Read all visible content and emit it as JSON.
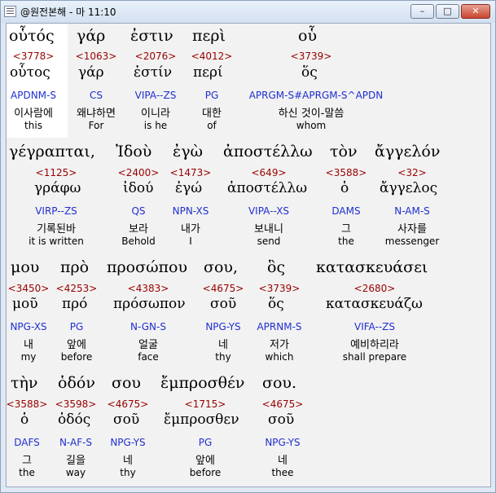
{
  "window": {
    "title": "@원전본해 - 마 11:10",
    "minimize": "–",
    "maximize": "□",
    "close": "✕"
  },
  "rows": [
    {
      "words": [
        {
          "greek": "οὗτός",
          "strong": "<3778>",
          "lemma": "οὗτος",
          "parse": "APDNM-S",
          "korean": "이사람에",
          "english": "this"
        },
        {
          "greek": "γάρ",
          "strong": "<1063>",
          "lemma": "γάρ",
          "parse": "CS",
          "korean": "왜냐하면",
          "english": "For"
        },
        {
          "greek": "ἐστιν",
          "strong": "<2076>",
          "lemma": "ἐστίν",
          "parse": "VIPA--ZS",
          "korean": "이니라",
          "english": "is he"
        },
        {
          "greek": "περὶ",
          "strong": "<4012>",
          "lemma": "περί",
          "parse": "PG",
          "korean": "대한",
          "english": "of"
        },
        {
          "greek": "οὗ",
          "strong": "<3739>",
          "lemma": "ὅς",
          "parse": "APRGM-S#APRGM-S^APDN",
          "korean": "하신 것이-말씀",
          "english": "whom"
        }
      ]
    },
    {
      "words": [
        {
          "greek": "γέγραπται,",
          "strong": "<1125>",
          "lemma": "γράφω",
          "parse": "VIRP--ZS",
          "korean": "기록된바",
          "english": "it is written"
        },
        {
          "greek": "Ἰδοὺ",
          "strong": "<2400>",
          "lemma": "ἰδού",
          "parse": "QS",
          "korean": "보라",
          "english": "Behold"
        },
        {
          "greek": "ἐγὼ",
          "strong": "<1473>",
          "lemma": "ἐγώ",
          "parse": "NPN-XS",
          "korean": "내가",
          "english": "I"
        },
        {
          "greek": "ἀποστέλλω",
          "strong": "<649>",
          "lemma": "ἀποστέλλω",
          "parse": "VIPA--XS",
          "korean": "보내니",
          "english": "send"
        },
        {
          "greek": "τὸν",
          "strong": "<3588>",
          "lemma": "ὁ",
          "parse": "DAMS",
          "korean": "그",
          "english": "the"
        },
        {
          "greek": "ἄγγελόν",
          "strong": "<32>",
          "lemma": "ἄγγελος",
          "parse": "N-AM-S",
          "korean": "사자를",
          "english": "messenger"
        }
      ]
    },
    {
      "words": [
        {
          "greek": "μου",
          "strong": "<3450>",
          "lemma": "μοῦ",
          "parse": "NPG-XS",
          "korean": "내",
          "english": "my"
        },
        {
          "greek": "πρὸ",
          "strong": "<4253>",
          "lemma": "πρό",
          "parse": "PG",
          "korean": "앞에",
          "english": "before"
        },
        {
          "greek": "προσώπου",
          "strong": "<4383>",
          "lemma": "πρόσωπον",
          "parse": "N-GN-S",
          "korean": "얼굴",
          "english": "face"
        },
        {
          "greek": "σου,",
          "strong": "<4675>",
          "lemma": "σοῦ",
          "parse": "NPG-YS",
          "korean": "네",
          "english": "thy"
        },
        {
          "greek": "ὃς",
          "strong": "<3739>",
          "lemma": "ὅς",
          "parse": "APRNM-S",
          "korean": "저가",
          "english": "which"
        },
        {
          "greek": "κατασκευάσει",
          "strong": "<2680>",
          "lemma": "κατασκευάζω",
          "parse": "VIFA--ZS",
          "korean": "예비하리라",
          "english": "shall prepare"
        }
      ]
    },
    {
      "words": [
        {
          "greek": "τὴν",
          "strong": "<3588>",
          "lemma": "ὁ",
          "parse": "DAFS",
          "korean": "그",
          "english": "the"
        },
        {
          "greek": "ὁδόν",
          "strong": "<3598>",
          "lemma": "ὁδός",
          "parse": "N-AF-S",
          "korean": "길을",
          "english": "way"
        },
        {
          "greek": "σου",
          "strong": "<4675>",
          "lemma": "σοῦ",
          "parse": "NPG-YS",
          "korean": "네",
          "english": "thy"
        },
        {
          "greek": "ἔμπροσθέν",
          "strong": "<1715>",
          "lemma": "ἔμπροσθεν",
          "parse": "PG",
          "korean": "앞에",
          "english": "before"
        },
        {
          "greek": "σου.",
          "strong": "<4675>",
          "lemma": "σοῦ",
          "parse": "NPG-YS",
          "korean": "네",
          "english": "thee"
        }
      ]
    }
  ]
}
